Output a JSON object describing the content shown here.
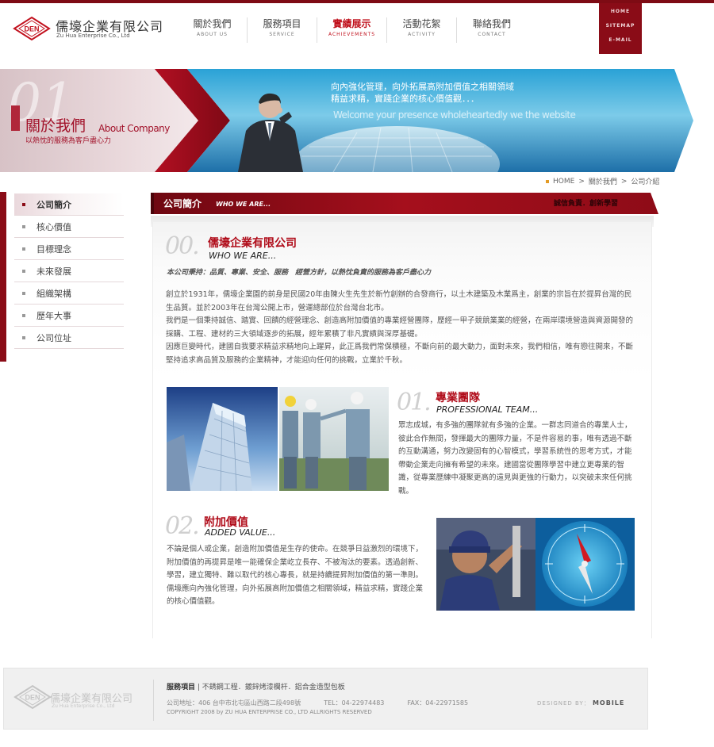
{
  "header": {
    "logo_mark": "DEN",
    "logo_cn": "儒壕企業有限公司",
    "logo_en": "Zu Hua Enterprise Co., Ltd",
    "nav": [
      {
        "cn": "關於我們",
        "en": "ABOUT US"
      },
      {
        "cn": "服務項目",
        "en": "SERVICE"
      },
      {
        "cn": "實績展示",
        "en": "ACHIEVEMENTS"
      },
      {
        "cn": "活動花絮",
        "en": "ACTIVITY"
      },
      {
        "cn": "聯絡我們",
        "en": "CONTACT"
      }
    ],
    "util_links": [
      "HOME",
      "SITEMAP",
      "E-MAIL"
    ]
  },
  "banner": {
    "number": "01",
    "title": "關於我們",
    "title_en": "About Company",
    "subtitle": "以熱忱的服務為客戶盡心力",
    "slogan_line1": "向內強化管理，向外拓展高附加價值之相關領域",
    "slogan_line2": "精益求精，實踐企業的核心價值觀．．．",
    "tagline": "Welcome your presence wholeheartedly we the website"
  },
  "breadcrumb": [
    "HOME",
    "關於我們",
    "公司介紹"
  ],
  "breadcrumb_sep": ">",
  "sidebar": {
    "items": [
      "公司簡介",
      "核心價值",
      "目標理念",
      "未來發展",
      "組織架構",
      "歷年大事",
      "公司位址"
    ]
  },
  "section": {
    "title": "公司簡介",
    "title_en": "WHO WE ARE...",
    "right_slogan": "誠信負責．創新學習"
  },
  "intro": {
    "num": "00.",
    "cn": "儒壕企業有限公司",
    "en": "WHO WE ARE...",
    "motto": "本公司秉持：品質、專業、安全、服務　經營方針，以熱忱負責的服務為客戶盡心力",
    "body": "創立於1931年，儒壕企業園的前身是民國20年由陳火生先生於新竹創辦的合發商行，以土木建築及木業爲主，創業的宗旨在於提昇台灣的民生品質。並於2003年在台灣公開上市，營運總部位於台灣台北市。\n我們是一個秉持誠信、踏實、回饋的經營理念、創造高附加價值的專業經營團隊，歷經一甲子競競業業的經營，在兩岸環境營造與資源開發的採購、工程、建材的三大領域逐步的拓展，經年累積了非凡實績與深厚基礎。\n因應巨變時代，建國自我要求精益求精地向上躍昇，此正爲我們常保積極，不斷向前的最大動力，面對未來，我們相信，唯有戀往開來，不斷堅持追求高品質及服務的企業精神，才能迎向任何的挑戰，立業於千秋。"
  },
  "team": {
    "num": "01.",
    "cn": "專業團隊",
    "en": "PROFESSIONAL TEAM...",
    "body": "眾志成城，有多強的團隊就有多強的企業。一群志同道合的專業人士，彼此合作無間，發揮最大的團隊力量，不是件容易的事，唯有透過不斷的互動溝通，努力改變固有的心智模式，學習系統性的思考方式，才能帶動企業走向擁有希望的未來。建國當從團隊學習中建立更專業的智識，從專業歷練中凝聚更高的遠見與更強的行動力，以突破未來任何挑戰。"
  },
  "value": {
    "num": "02.",
    "cn": "附加價值",
    "en": "ADDED VALUE...",
    "body": "不論是個人或企業，創造附加價值是生存的使命。在競爭日益激烈的環境下，附加價值的再提昇是唯一能確保企業屹立長存、不被淘汰的要素。透過創新、學習，建立獨特、難以取代的核心專長，就是持續提昇附加價值的第一準則。儒壕應向內強化管理，向外拓展高附加價值之相關領域，精益求精，實踐企業的核心價值觀。"
  },
  "footer": {
    "logo_cn": "儒壕企業有限公司",
    "logo_en": "Zu Hua Enterprise Co., Ltd",
    "service_label": "服務項目",
    "service_text": "不銹鋼工程．鍍鋅烤漆欄杆．鋁合金造型包板",
    "address": "公司地址：406 台中市北屯區山西路二段498號",
    "tel": "TEL：04-22974483",
    "fax": "FAX：04-22971585",
    "copyright": "COPYRIGHT 2008 by ZU HUA ENTERPRISE CO., LTD ALLRIGHTS RESERVED",
    "designed_by_label": "DESIGNED BY：",
    "designed_by": "MOBILE"
  },
  "colors": {
    "brand_red": "#8a0c17",
    "accent_red": "#b00c1a",
    "breadcrumb_dot": "#e39b25"
  }
}
